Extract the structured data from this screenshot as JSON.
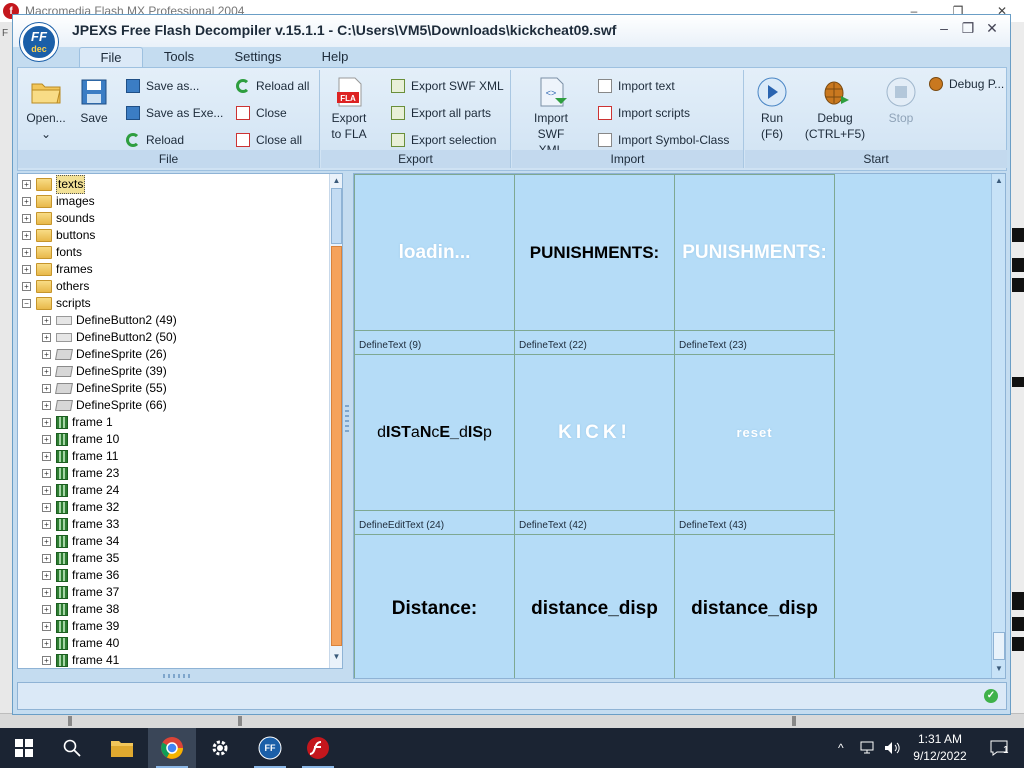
{
  "background_app": {
    "title": "Macromedia Flash MX Professional 2004",
    "icon_letter": "f",
    "left_strip_letter": "F",
    "controls": [
      "–",
      "❐",
      "✕"
    ]
  },
  "window": {
    "title": "JPEXS Free Flash Decompiler v.15.1.1 - C:\\Users\\VM5\\Downloads\\kickcheat09.swf",
    "logo_line1": "FF",
    "logo_line2": "dec",
    "controls": [
      "–",
      "❐",
      "✕"
    ]
  },
  "menu_tabs": [
    "File",
    "Tools",
    "Settings",
    "Help"
  ],
  "ribbon": {
    "file_group": {
      "label": "File",
      "open": "Open...",
      "open_arrow": "⌄",
      "save": "Save",
      "save_as": "Save as...",
      "save_as_exe": "Save as Exe...",
      "reload": "Reload",
      "reload_all": "Reload all",
      "close": "Close",
      "close_all": "Close all"
    },
    "export_group": {
      "label": "Export",
      "export_to_fla_l1": "Export",
      "export_to_fla_l2": "to FLA",
      "fla_badge": "FLA",
      "export_swf_xml": "Export SWF XML",
      "export_all_parts": "Export all parts",
      "export_selection": "Export selection"
    },
    "import_group": {
      "label": "Import",
      "import_swf_xml_l1": "Import",
      "import_swf_xml_l2": "SWF XML",
      "import_text": "Import text",
      "import_scripts": "Import scripts",
      "import_symbol_class": "Import Symbol-Class"
    },
    "start_group": {
      "label": "Start",
      "run_l1": "Run",
      "run_l2": "(F6)",
      "debug_l1": "Debug",
      "debug_l2": "(CTRL+F5)",
      "stop": "Stop",
      "debug_p": "Debug P..."
    }
  },
  "tree": {
    "top_level": [
      {
        "label": "texts",
        "icon": "folder-icon",
        "selected": true
      },
      {
        "label": "images",
        "icon": "folder-icon"
      },
      {
        "label": "sounds",
        "icon": "folder-icon"
      },
      {
        "label": "buttons",
        "icon": "folder-icon"
      },
      {
        "label": "fonts",
        "icon": "folder-icon"
      },
      {
        "label": "frames",
        "icon": "folder-icon"
      },
      {
        "label": "others",
        "icon": "folder-icon"
      },
      {
        "label": "scripts",
        "icon": "folder-icon",
        "expanded": true
      }
    ],
    "scripts_children": [
      {
        "label": "DefineButton2 (49)",
        "icon": "button-icon"
      },
      {
        "label": "DefineButton2 (50)",
        "icon": "button-icon"
      },
      {
        "label": "DefineSprite (26)",
        "icon": "sprite-icon"
      },
      {
        "label": "DefineSprite (39)",
        "icon": "sprite-icon"
      },
      {
        "label": "DefineSprite (55)",
        "icon": "sprite-icon"
      },
      {
        "label": "DefineSprite (66)",
        "icon": "sprite-icon"
      },
      {
        "label": "frame 1",
        "icon": "frame-icon"
      },
      {
        "label": "frame 10",
        "icon": "frame-icon"
      },
      {
        "label": "frame 11",
        "icon": "frame-icon"
      },
      {
        "label": "frame 23",
        "icon": "frame-icon"
      },
      {
        "label": "frame 24",
        "icon": "frame-icon"
      },
      {
        "label": "frame 32",
        "icon": "frame-icon"
      },
      {
        "label": "frame 33",
        "icon": "frame-icon"
      },
      {
        "label": "frame 34",
        "icon": "frame-icon"
      },
      {
        "label": "frame 35",
        "icon": "frame-icon"
      },
      {
        "label": "frame 36",
        "icon": "frame-icon"
      },
      {
        "label": "frame 37",
        "icon": "frame-icon"
      },
      {
        "label": "frame 38",
        "icon": "frame-icon"
      },
      {
        "label": "frame 39",
        "icon": "frame-icon"
      },
      {
        "label": "frame 40",
        "icon": "frame-icon"
      },
      {
        "label": "frame 41",
        "icon": "frame-icon"
      }
    ],
    "expand_plus": "+",
    "expand_minus": "−"
  },
  "preview": {
    "cells": [
      {
        "display": "loadin...",
        "style": "white",
        "caption": "DefineText (9)"
      },
      {
        "display": "PUNISHMENTS:",
        "style": "black",
        "caption": "DefineText (22)"
      },
      {
        "display": "PUNISHMENTS:",
        "style": "white",
        "caption": "DefineText (23)"
      },
      {
        "display": "dISTaNcE_dISp",
        "style": "mixed",
        "caption": "DefineEditText (24)"
      },
      {
        "display": "KICK!",
        "style": "white-spaced",
        "caption": "DefineText (42)"
      },
      {
        "display": "reset",
        "style": "white-small",
        "caption": "DefineText (43)"
      },
      {
        "display": "Distance:",
        "style": "big",
        "caption": ""
      },
      {
        "display": "distance_disp",
        "style": "big",
        "caption": ""
      },
      {
        "display": "distance_disp",
        "style": "big",
        "caption": ""
      }
    ]
  },
  "status": {
    "ok_symbol": "✓"
  },
  "taskbar": {
    "time": "1:31 AM",
    "date": "9/12/2022",
    "tray_up": "^",
    "notification_count": "1"
  },
  "colors": {
    "window_bg": "#c4dcf0",
    "preview_bg": "#b5dcf7",
    "scroll_thumb": "#f5a25b",
    "taskbar": "#1b2433"
  }
}
